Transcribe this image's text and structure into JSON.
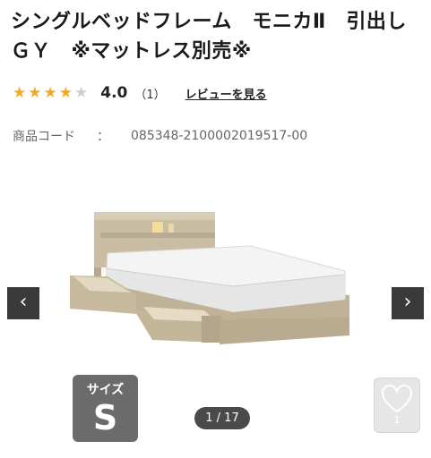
{
  "product": {
    "title": "シングルベッドフレーム　モニカⅡ　引出し　ＧＹ　※マットレス別売※",
    "rating": {
      "stars_filled": 4,
      "stars_total": 5,
      "value": "4.0",
      "count": "（1）",
      "review_link": "レビューを見る"
    },
    "code": {
      "label": "商品コード",
      "separator": "：",
      "value": "085348-2100002019517-00"
    }
  },
  "gallery": {
    "prev_label": "‹",
    "next_label": "›",
    "pager": "1 / 17"
  },
  "size_badge": {
    "label": "サイズ",
    "value": "S"
  },
  "favorite": {
    "count": "1"
  },
  "colors": {
    "star_on": "#f3a923",
    "star_off": "#cfcfcf",
    "nav_bg": "#3a3a3a",
    "badge_bg": "#6b6b6b"
  }
}
